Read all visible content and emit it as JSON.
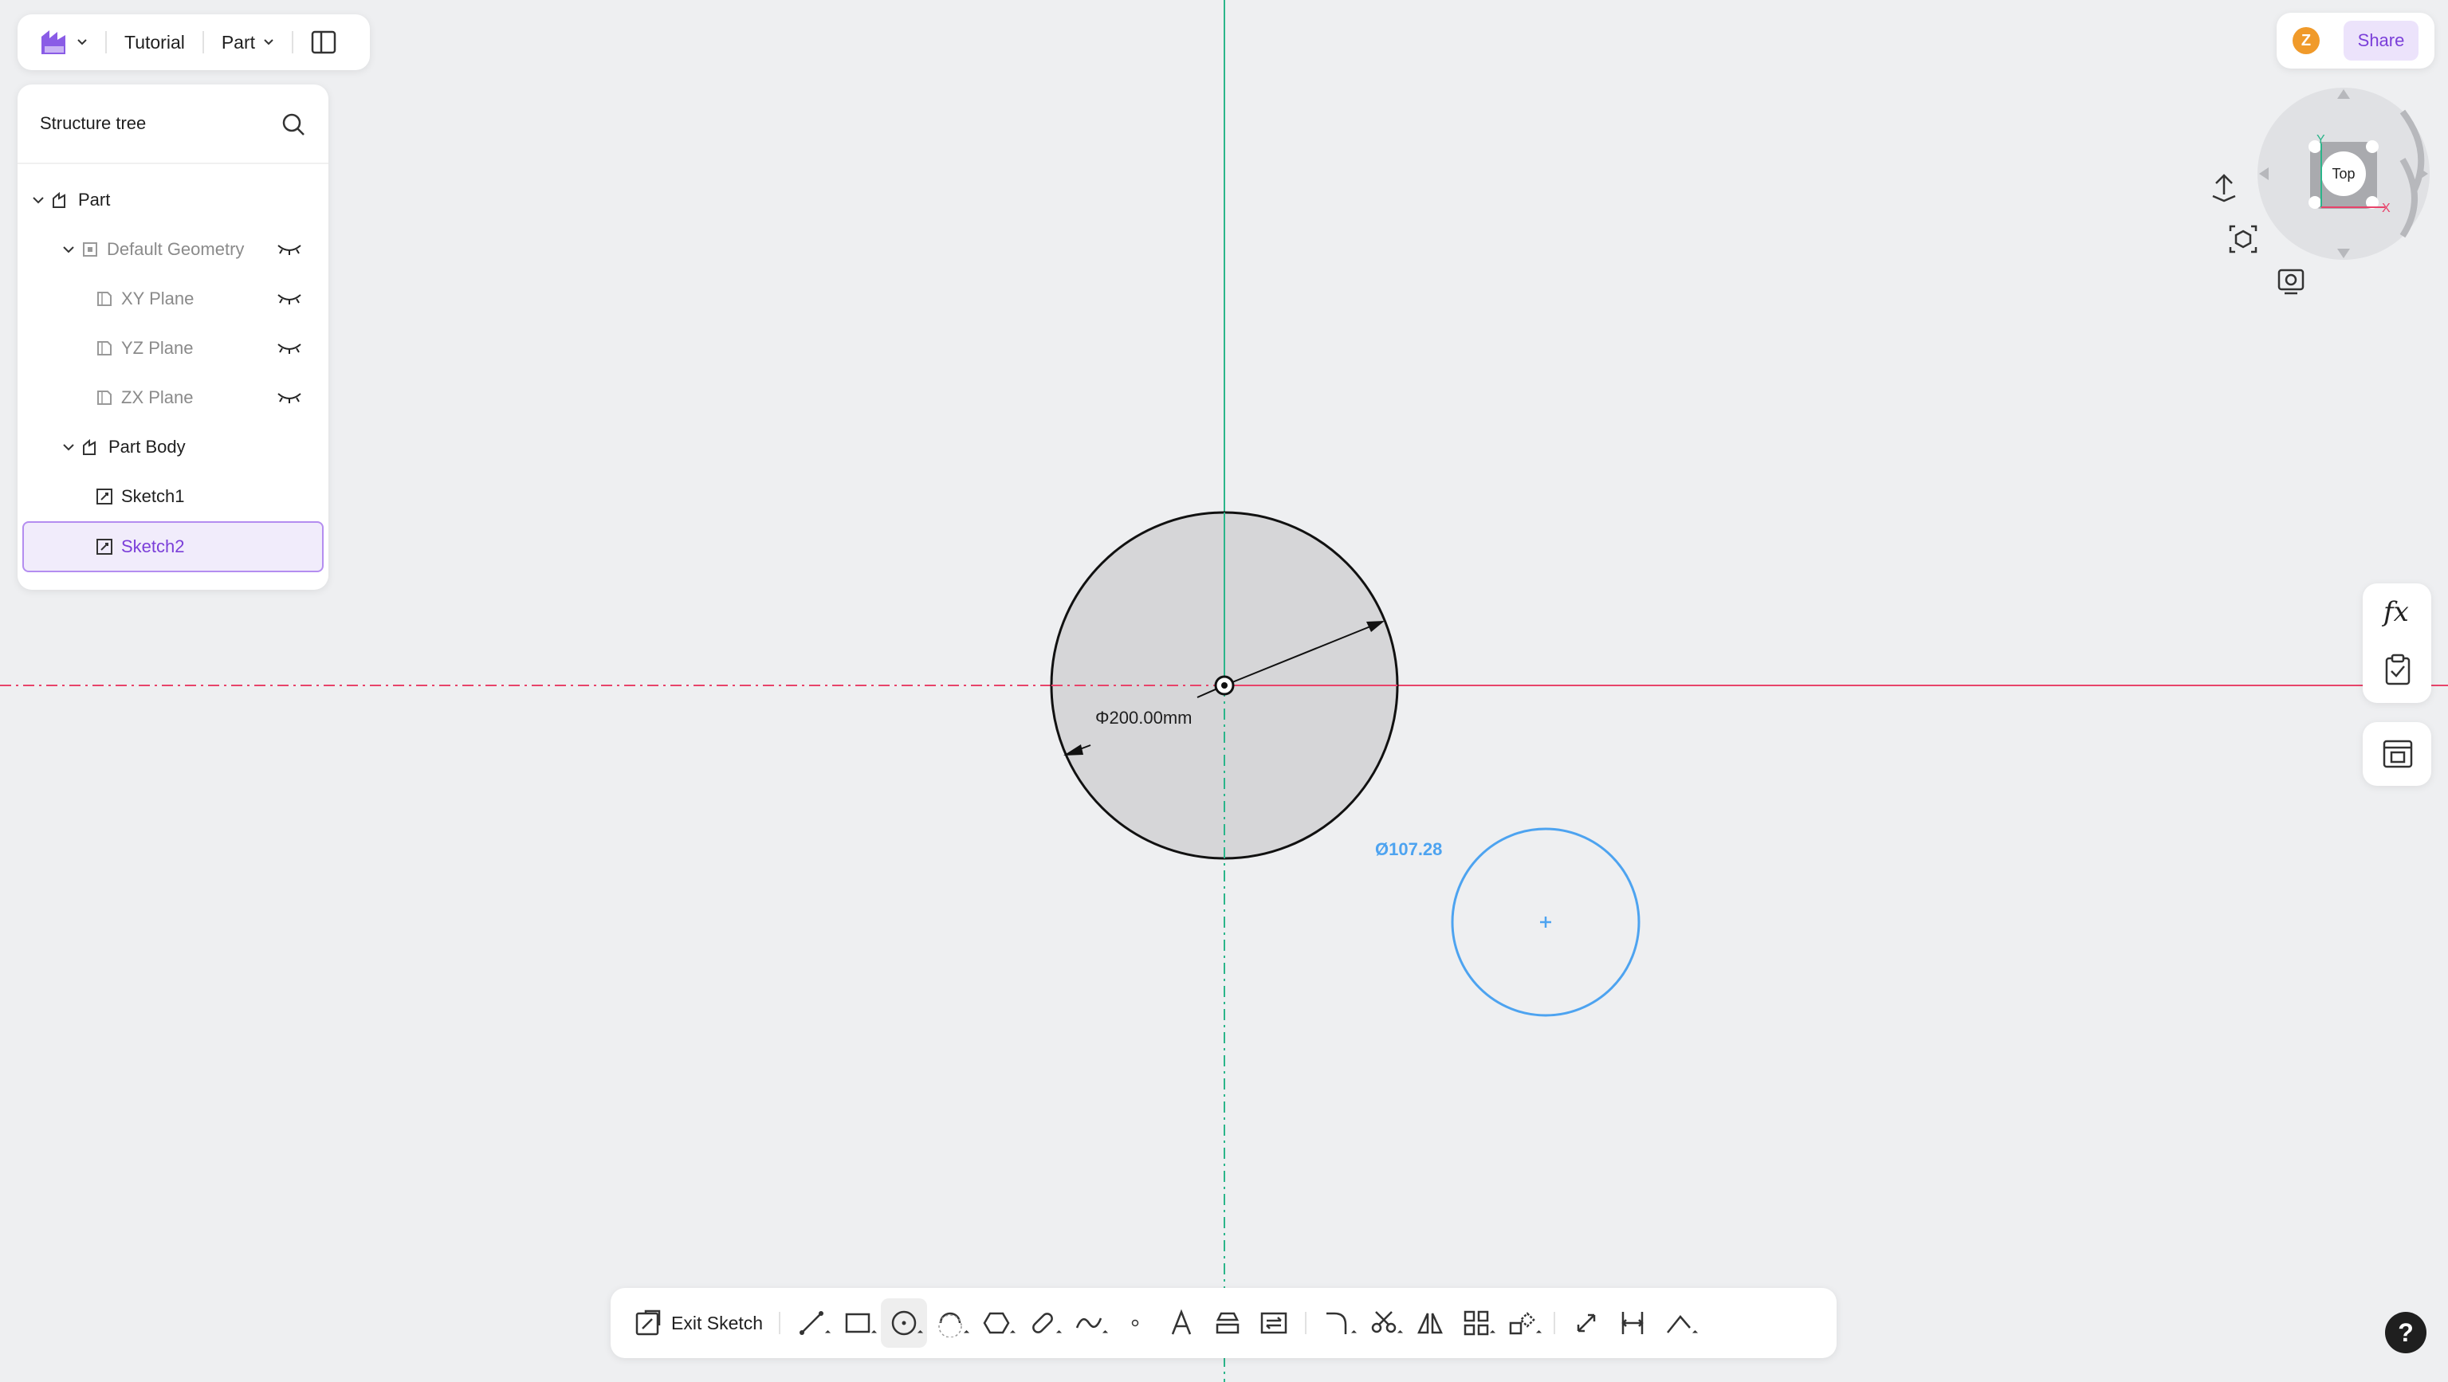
{
  "app": {
    "brand_icon": "app-logo-icon",
    "project_name": "Tutorial",
    "mode_label": "Part",
    "panel_toggle_icon": "panel-toggle-icon"
  },
  "structure_tree": {
    "title": "Structure tree",
    "items": [
      {
        "label": "Part",
        "level": 0,
        "expanded": true,
        "state": "normal"
      },
      {
        "label": "Default Geometry",
        "level": 1,
        "expanded": true,
        "state": "hidden"
      },
      {
        "label": "XY Plane",
        "level": 2,
        "state": "hidden"
      },
      {
        "label": "YZ Plane",
        "level": 2,
        "state": "hidden"
      },
      {
        "label": "ZX Plane",
        "level": 2,
        "state": "hidden"
      },
      {
        "label": "Part Body",
        "level": 1,
        "expanded": true,
        "state": "normal"
      },
      {
        "label": "Sketch1",
        "level": 2,
        "state": "normal"
      },
      {
        "label": "Sketch2",
        "level": 2,
        "state": "selected"
      }
    ]
  },
  "header_right": {
    "avatar_initial": "Z",
    "share_label": "Share"
  },
  "view_cube": {
    "face_label": "Top",
    "axis_y": "Y",
    "axis_x": "X"
  },
  "canvas": {
    "dimension_label": "Φ200.00mm",
    "preview_diameter_label": "Ø107.28"
  },
  "toolbar": {
    "exit_label": "Exit Sketch",
    "tools": [
      "line-tool-icon",
      "rectangle-tool-icon",
      "circle-tool-icon",
      "arc-tool-icon",
      "polygon-tool-icon",
      "slot-tool-icon",
      "spline-tool-icon",
      "point-tool-icon",
      "text-tool-icon",
      "project-tool-icon",
      "convert-tool-icon",
      "fillet-tool-icon",
      "trim-tool-icon",
      "mirror-tool-icon",
      "pattern-tool-icon",
      "transform-tool-icon",
      "dimension-tool-icon",
      "constraint-tool-icon",
      "construction-tool-icon"
    ],
    "active_tool": "circle-tool-icon"
  },
  "right_tools": {
    "formula_label": "fx"
  },
  "help_label": "?",
  "colors": {
    "accent": "#7b3fd9",
    "x_axis": "#e8436a",
    "y_axis": "#2bb58a",
    "preview": "#4da3f0"
  }
}
